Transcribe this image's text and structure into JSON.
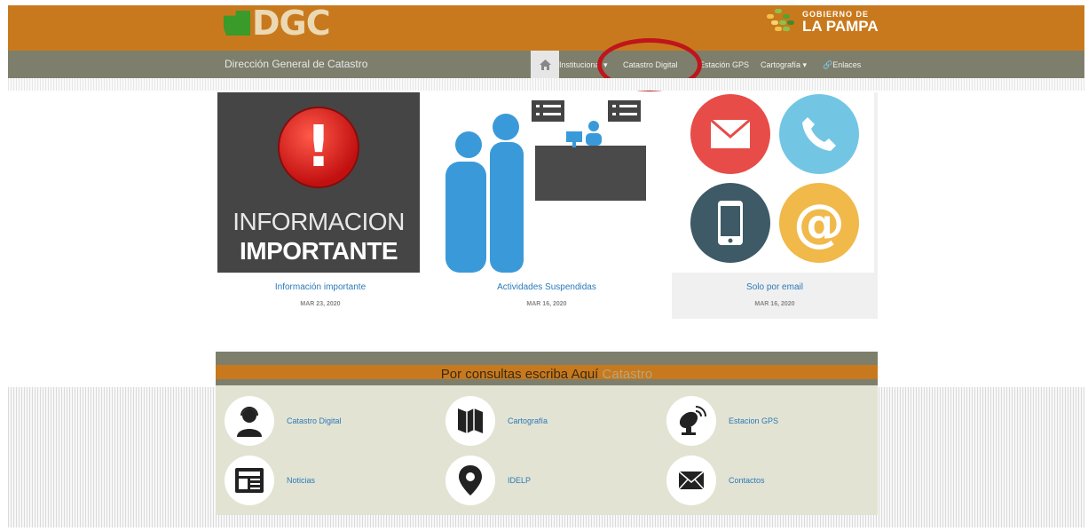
{
  "header": {
    "logo_text": "DGC",
    "gov_line1": "GOBIERNO DE",
    "gov_line2": "LA PAMPA"
  },
  "navbar": {
    "brand": "Dirección General de Catastro",
    "items": [
      {
        "label": "Institucional"
      },
      {
        "label": "Catastro Digital"
      },
      {
        "label": "Estación GPS"
      },
      {
        "label": "Cartografía"
      },
      {
        "label": "Enlaces"
      }
    ]
  },
  "cards": [
    {
      "title": "Información importante",
      "date": "MAR 23, 2020",
      "image_line1": "INFORMACION",
      "image_line2": "IMPORTANTE"
    },
    {
      "title": "Actividades Suspendidas",
      "date": "MAR 16, 2020"
    },
    {
      "title": "Solo por email",
      "date": "MAR 16, 2020"
    }
  ],
  "footer": {
    "banner_text": "Por consultas escriba Aquí",
    "banner_link": "Catastro",
    "links": [
      {
        "label": "Catastro Digital",
        "icon": "person-headset-icon"
      },
      {
        "label": "Cartografía",
        "icon": "map-icon"
      },
      {
        "label": "Estacion GPS",
        "icon": "satellite-dish-icon"
      },
      {
        "label": "Noticias",
        "icon": "newspaper-icon"
      },
      {
        "label": "IDELP",
        "icon": "location-pin-icon"
      },
      {
        "label": "Contactos",
        "icon": "envelope-icon"
      }
    ]
  },
  "colors": {
    "brand_orange": "#c9791d",
    "nav_gray": "#7d7f6c",
    "link_blue": "#2a7ab8",
    "annotation_red": "#c0151b"
  }
}
